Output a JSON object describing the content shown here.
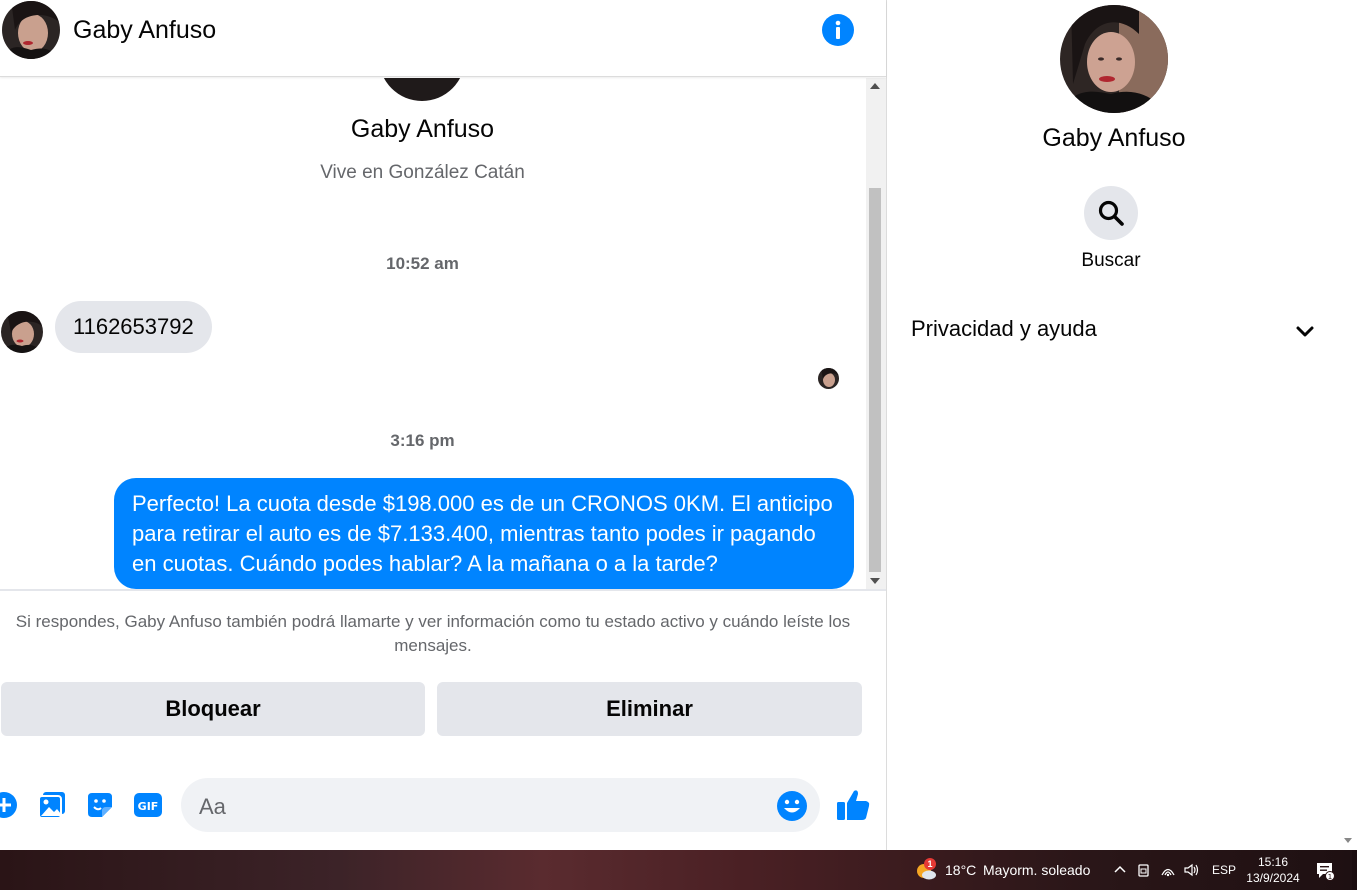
{
  "colors": {
    "accent": "#0084ff",
    "bubble_in": "#e4e6eb",
    "text_secondary": "#65676b"
  },
  "header": {
    "contact_name": "Gaby Anfuso",
    "info_icon": "info-icon"
  },
  "conversation": {
    "profile_name": "Gaby Anfuso",
    "profile_location": "Vive en González Catán",
    "timestamp_1": "10:52 am",
    "incoming_message": "1162653792",
    "timestamp_2": "3:16 pm",
    "outgoing_message": "Perfecto! La cuota desde $198.000 es de un CRONOS 0KM. El anticipo para retirar el auto es de $7.133.400, mientras tanto podes ir pagando en cuotas. Cuándo podes hablar? A la mañana o a la tarde?"
  },
  "request_notice": "Si respondes, Gaby Anfuso también podrá llamarte y ver información como tu estado activo y cuándo leíste los mensajes.",
  "actions": {
    "block_label": "Bloquear",
    "delete_label": "Eliminar"
  },
  "composer": {
    "placeholder": "Aa",
    "icons": [
      "plus-icon",
      "photo-icon",
      "sticker-icon",
      "gif-icon",
      "emoji-icon",
      "thumbs-up-icon"
    ]
  },
  "info_panel": {
    "name": "Gaby Anfuso",
    "search_label": "Buscar",
    "privacy_label": "Privacidad y ayuda"
  },
  "taskbar": {
    "weather_badge": "1",
    "weather_temp": "18°C",
    "weather_desc": "Mayorm. soleado",
    "language": "ESP",
    "time": "15:16",
    "date": "13/9/2024",
    "notification_count": "1"
  }
}
